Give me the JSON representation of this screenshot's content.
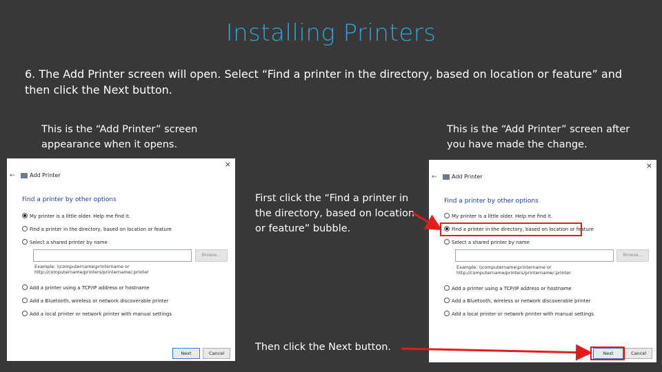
{
  "slide": {
    "title": "Installing Printers",
    "instruction": "6. The Add Printer screen will open.  Select “Find a printer in the directory, based on location or feature” and then click the Next button.",
    "caption_left": "This is the “Add Printer” screen appearance when it opens.",
    "caption_right": "This is the “Add Printer” screen after you have made the change.",
    "note_first": "First click the “Find a printer in the directory, based on location or feature” bubble.",
    "note_then": "Then click the Next button.",
    "accent_color": "#2aa7dd",
    "highlight_color": "#e31b1b"
  },
  "dialog_left": {
    "close": "×",
    "back": "←",
    "title": "Add Printer",
    "heading": "Find a printer by other options",
    "options": [
      "My printer is a little older. Help me find it.",
      "Find a printer in the directory, based on location or feature",
      "Select a shared printer by name",
      "Add a printer using a TCP/IP address or hostname",
      "Add a Bluetooth, wireless or network discoverable printer",
      "Add a local printer or network printer with manual settings"
    ],
    "selected_option": 0,
    "browse_label": "Browse...",
    "example_line1": "Example: \\\\computername\\printername or",
    "example_line2": "http://computername/printers/printername/.printer",
    "next_label": "Next",
    "cancel_label": "Cancel"
  },
  "dialog_right": {
    "close": "×",
    "back": "←",
    "title": "Add Printer",
    "heading": "Find a printer by other options",
    "options": [
      "My printer is a little older. Help me find it.",
      "Find a printer in the directory, based on location or feature",
      "Select a shared printer by name",
      "Add a printer using a TCP/IP address or hostname",
      "Add a Bluetooth, wireless or network discoverable printer",
      "Add a local printer or network printer with manual settings"
    ],
    "selected_option": 1,
    "browse_label": "Browse...",
    "example_line1": "Example: \\\\computername\\printername or",
    "example_line2": "http://computername/printers/printername/.printer",
    "next_label": "Next",
    "cancel_label": "Cancel"
  }
}
